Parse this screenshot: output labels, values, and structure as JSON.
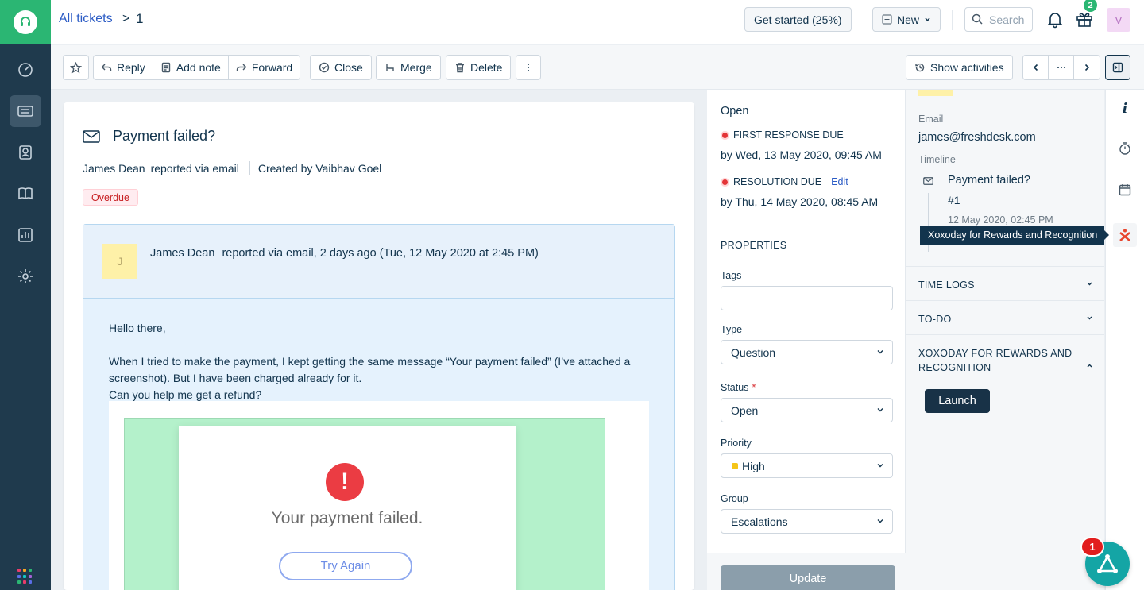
{
  "header": {
    "breadcrumb": "All tickets",
    "breadcrumb_sep": ">",
    "ticket_id": "1",
    "get_started": "Get started (25%)",
    "new_label": "New",
    "search_placeholder": "Search",
    "gift_badge": "2",
    "avatar_initial": "V"
  },
  "toolbar": {
    "reply": "Reply",
    "add_note": "Add note",
    "forward": "Forward",
    "close": "Close",
    "merge": "Merge",
    "delete": "Delete",
    "show_activities": "Show activities"
  },
  "ticket": {
    "subject": "Payment failed?",
    "requester": "James Dean",
    "reported_via": "reported via email",
    "created_by": "Created by Vaibhav Goel",
    "tag": "Overdue",
    "conversation": {
      "avatar_initial": "J",
      "from": "James Dean",
      "meta": "reported via email, 2 days ago (Tue, 12 May 2020 at 2:45 PM)",
      "greeting": "Hello there,",
      "body_1": "When I tried to make the payment, I kept getting the same message “Your payment failed” (I’ve attached a screenshot). But I have been charged already for it.",
      "body_2": "Can you help me get a refund?",
      "screenshot_text": "Your payment failed.",
      "screenshot_button": "Try Again",
      "screenshot_icon": "!"
    }
  },
  "properties": {
    "status_title": "Open",
    "first_response_label": "FIRST RESPONSE DUE",
    "first_response_date": "by Wed, 13 May 2020, 09:45 AM",
    "resolution_label": "RESOLUTION DUE",
    "resolution_edit": "Edit",
    "resolution_date": "by Thu, 14 May 2020, 08:45 AM",
    "section_title": "PROPERTIES",
    "tags_label": "Tags",
    "type_label": "Type",
    "type_value": "Question",
    "status_label": "Status",
    "status_required": "*",
    "status_value": "Open",
    "priority_label": "Priority",
    "priority_value": "High",
    "priority_color": "#f5c518",
    "group_label": "Group",
    "group_value": "Escalations",
    "update_button": "Update"
  },
  "contact": {
    "email_label": "Email",
    "email_value": "james@freshdesk.com",
    "timeline_label": "Timeline",
    "timeline_title": "Payment failed?",
    "timeline_id": "#1",
    "timeline_date": "12 May 2020, 02:45 PM",
    "time_logs": "TIME LOGS",
    "todo": "TO-DO",
    "xoxoday": "XOXODAY FOR REWARDS AND RECOGNITION",
    "launch": "Launch"
  },
  "tooltip": "Xoxoday for Rewards and Recognition",
  "fab_badge": "1",
  "colors": {
    "brand_green": "#2bb673",
    "nav_dark": "#1f3a4d",
    "link_blue": "#2c5cc5",
    "overdue_red": "#c82124"
  }
}
